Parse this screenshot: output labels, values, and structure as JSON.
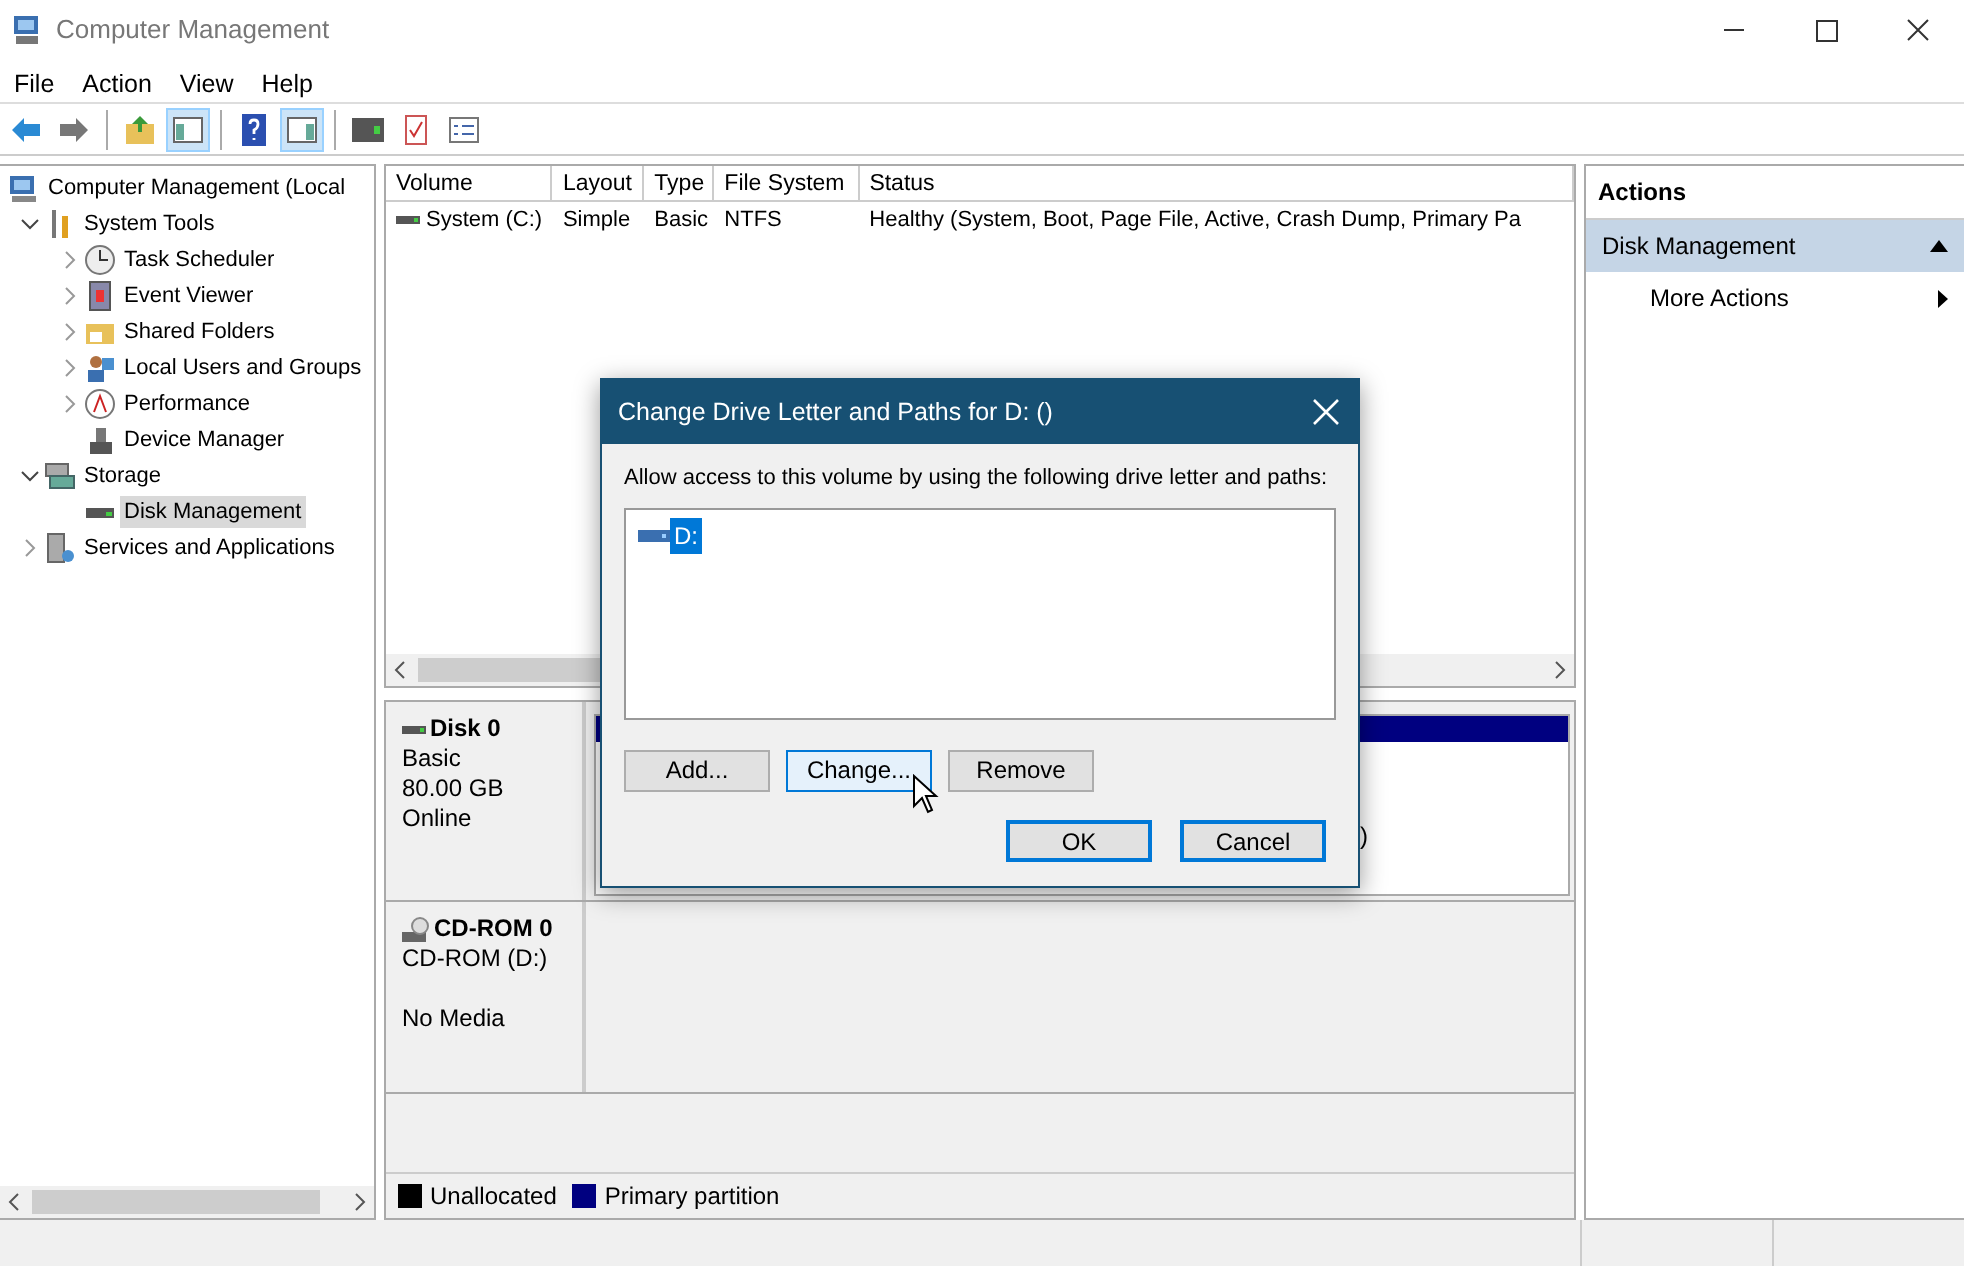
{
  "window": {
    "title": "Computer Management"
  },
  "menu": [
    "File",
    "Action",
    "View",
    "Help"
  ],
  "toolbar": [
    {
      "kind": "back",
      "pressed": false
    },
    {
      "kind": "forward",
      "pressed": false
    },
    {
      "kind": "sep"
    },
    {
      "kind": "up",
      "pressed": false
    },
    {
      "kind": "tree",
      "pressed": true
    },
    {
      "kind": "sep"
    },
    {
      "kind": "help",
      "pressed": false
    },
    {
      "kind": "pane",
      "pressed": true
    },
    {
      "kind": "sep"
    },
    {
      "kind": "connect",
      "pressed": false
    },
    {
      "kind": "check",
      "pressed": false
    },
    {
      "kind": "list",
      "pressed": false
    }
  ],
  "tree": [
    {
      "label": "Computer Management (Local",
      "kind": "computer",
      "selected": false,
      "children": [
        {
          "label": "System Tools",
          "kind": "tools",
          "expanded": true,
          "selected": false,
          "children": [
            {
              "label": "Task Scheduler",
              "kind": "clock",
              "expanded": false,
              "selected": false
            },
            {
              "label": "Event Viewer",
              "kind": "event",
              "expanded": false,
              "selected": false
            },
            {
              "label": "Shared Folders",
              "kind": "folder",
              "expanded": false,
              "selected": false
            },
            {
              "label": "Local Users and Groups",
              "kind": "users",
              "expanded": false,
              "selected": false
            },
            {
              "label": "Performance",
              "kind": "perf",
              "expanded": false,
              "selected": false
            },
            {
              "label": "Device Manager",
              "kind": "device",
              "selected": false
            }
          ]
        },
        {
          "label": "Storage",
          "kind": "storage",
          "expanded": true,
          "selected": false,
          "children": [
            {
              "label": "Disk Management",
              "kind": "disk",
              "selected": true
            }
          ]
        },
        {
          "label": "Services and Applications",
          "kind": "services",
          "expanded": false,
          "selected": false
        }
      ]
    }
  ],
  "volumes": {
    "columns": [
      "Volume",
      "Layout",
      "Type",
      "File System",
      "Status"
    ],
    "rows": [
      [
        "System (C:)",
        "Simple",
        "Basic",
        "NTFS",
        "Healthy (System, Boot, Page File, Active, Crash Dump, Primary Pa"
      ]
    ]
  },
  "disks": [
    {
      "kind": "disk",
      "name": "Disk 0",
      "lines": [
        "Basic",
        "80.00 GB",
        "Online"
      ],
      "partition_text": ")"
    },
    {
      "kind": "cdrom",
      "name": "CD-ROM 0",
      "lines": [
        "CD-ROM (D:)",
        "No Media"
      ]
    }
  ],
  "legend": [
    {
      "label": "Unallocated",
      "color": "#000000"
    },
    {
      "label": "Primary partition",
      "color": "#000080"
    }
  ],
  "actions": {
    "header": "Actions",
    "items": [
      {
        "kind": "group",
        "label": "Disk Management",
        "expanded": true
      },
      {
        "kind": "submenu",
        "label": "More Actions"
      }
    ]
  },
  "dialog": {
    "title": "Change Drive Letter and Paths for D: ()",
    "prompt": "Allow access to this volume by using the following drive letter and paths:",
    "paths": [
      {
        "label": "D:",
        "selected": true
      }
    ],
    "buttons": [
      {
        "label": "Add...",
        "kind": "path",
        "hovered": false
      },
      {
        "label": "Change...",
        "kind": "path",
        "hovered": true
      },
      {
        "label": "Remove",
        "kind": "path",
        "hovered": false
      },
      {
        "label": "OK",
        "kind": "confirm",
        "hovered": false
      },
      {
        "label": "Cancel",
        "kind": "confirm",
        "hovered": false
      }
    ]
  }
}
